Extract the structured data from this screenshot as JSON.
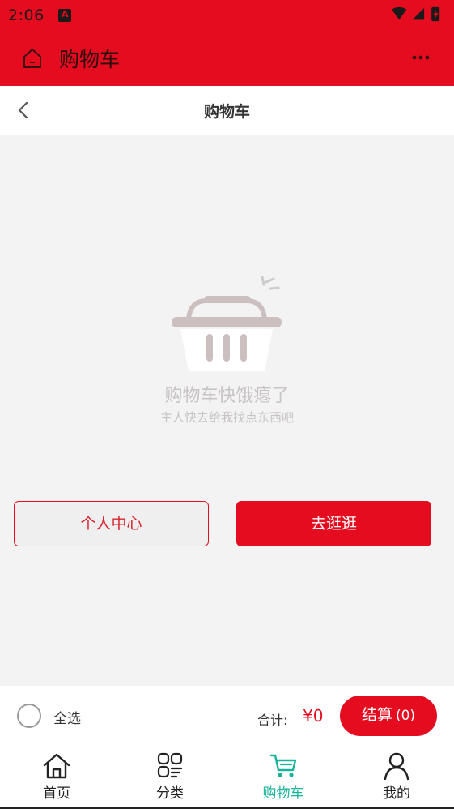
{
  "status_bar": {
    "time": "2:06"
  },
  "app_bar": {
    "title": "购物车",
    "home_icon": "home-icon",
    "more_icon": "more-icon"
  },
  "nav_bar": {
    "title": "购物车",
    "back_icon": "chevron-left-icon"
  },
  "empty_state": {
    "icon": "basket-icon",
    "title": "购物车快饿瘪了",
    "subtitle": "主人快去给我找点东西吧"
  },
  "buttons": {
    "personal_center": "个人中心",
    "go_shopping": "去逛逛"
  },
  "checkout": {
    "select_all": "全选",
    "total_label": "合计:",
    "total_value": "¥0",
    "pay_label": "结算",
    "pay_count": "(0)"
  },
  "tabbar": {
    "items": [
      {
        "label": "首页",
        "icon": "home-icon",
        "active": false
      },
      {
        "label": "分类",
        "icon": "category-icon",
        "active": false
      },
      {
        "label": "购物车",
        "icon": "cart-icon",
        "active": true
      },
      {
        "label": "我的",
        "icon": "user-icon",
        "active": false
      }
    ]
  },
  "colors": {
    "brand_red": "#e50c1f",
    "active_tab": "#18b39a"
  }
}
